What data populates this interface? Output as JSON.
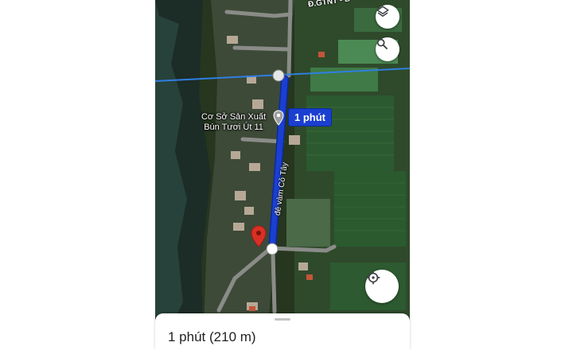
{
  "map": {
    "road_top_label": "Đ.GTNT - B",
    "place_name_line1": "Cơ Sở Sản Xuất",
    "place_name_line2": "Bún Tươi Út 11",
    "street_label": "đê vàm Cỏ Tây",
    "route_duration_badge": "1 phút",
    "route_color": "#1a3fd1"
  },
  "controls": {
    "layers_icon": "layers-icon",
    "search_icon": "search-icon",
    "locate_icon": "my-location-icon"
  },
  "sheet": {
    "duration": "1 phút",
    "distance": "(210 m)"
  }
}
